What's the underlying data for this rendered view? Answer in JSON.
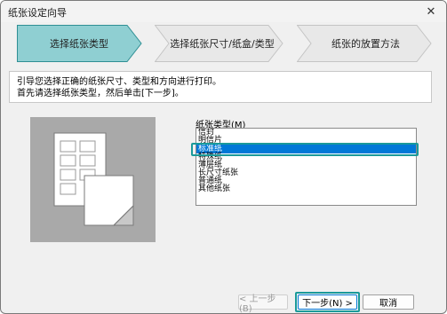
{
  "window": {
    "title": "纸张设定向导",
    "close_glyph": "✕"
  },
  "wizard": {
    "steps": [
      {
        "label": "选择纸张类型",
        "active": true
      },
      {
        "label": "选择纸张尺寸/纸盒/类型",
        "active": false
      },
      {
        "label": "纸张的放置方法",
        "active": false
      }
    ],
    "colors": {
      "active_fill": "#8fcfd2",
      "active_stroke": "#2f8f94",
      "inactive_fill": "#e8e8e8",
      "inactive_stroke": "#c4c4c4"
    }
  },
  "instructions": {
    "line1": "引导您选择正确的纸张尺寸、类型和方向进行打印。",
    "line2": "首先请选择纸张类型，然后单击[下一步]。"
  },
  "paper_type": {
    "label": "纸张类型(M)",
    "items": [
      "信封",
      "明信片",
      "标准纸",
      "特殊纸",
      "薄层纸",
      "长尺寸纸张",
      "普通纸",
      "其他纸张"
    ],
    "selected_index": 2
  },
  "buttons": {
    "back": "< 上一步(B)",
    "next": "下一步(N) >",
    "cancel": "取消"
  }
}
